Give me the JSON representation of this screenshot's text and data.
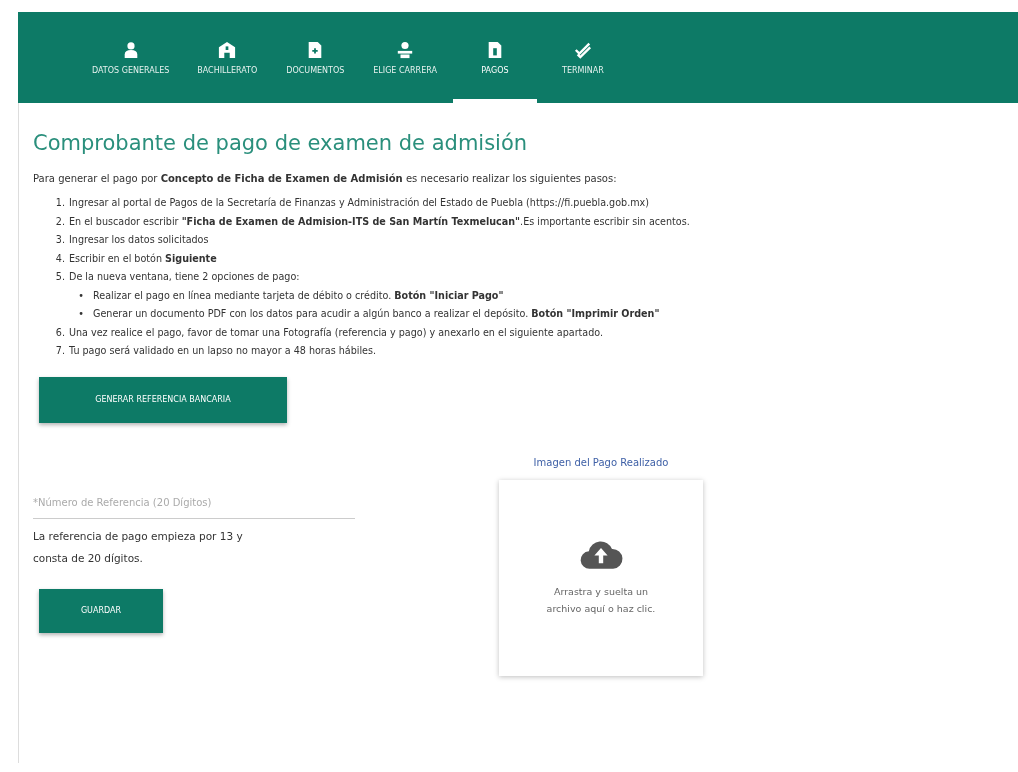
{
  "tabs": [
    {
      "label": "DATOS GENERALES",
      "kind": "person",
      "selected": false
    },
    {
      "label": "BACHILLERATO",
      "kind": "school",
      "selected": false
    },
    {
      "label": "DOCUMENTOS",
      "kind": "file",
      "selected": false
    },
    {
      "label": "ELIGE CARRERA",
      "kind": "career",
      "selected": false
    },
    {
      "label": "PAGOS",
      "kind": "payment",
      "selected": true
    },
    {
      "label": "TERMINAR",
      "kind": "check",
      "selected": false
    }
  ],
  "title": "Comprobante de pago de examen de admisión",
  "intro": "Para generar el pago por **Concepto de Ficha de Examen de Admisión** es necesario realizar los siguientes pasos:",
  "steps": [
    {
      "number": "1.",
      "text": "Ingresar al portal de Pagos de la Secretaría de Finanzas y Administración del Estado de Puebla (https://fi.puebla.gob.mx)"
    },
    {
      "number": "2.",
      "text": "En el buscador escribir **\"Ficha de Examen de Admision-ITS de San Martín Texmelucan\"**.Es importante escribir sin acentos."
    },
    {
      "number": "3.",
      "text": "Ingresar los datos solicitados"
    },
    {
      "number": "4.",
      "text": "Escribir en el botón **Siguiente**"
    },
    {
      "number": "5.",
      "text": "De la nueva ventana, tiene 2 opciones de pago:",
      "children": [
        {
          "bullet": "•",
          "text": "Realizar el pago en línea mediante tarjeta de débito o crédito. **Botón \"Iniciar Pago\"**"
        },
        {
          "bullet": "•",
          "text": "Generar un documento PDF con los datos para acudir a algún banco a realizar el depósito. **Botón \"Imprimir Orden\"**"
        }
      ]
    },
    {
      "number": "6.",
      "text": "Una vez realice el pago, favor de tomar una Fotografía (referencia y pago) y anexarlo en el siguiente apartado."
    },
    {
      "number": "7.",
      "text": "Tu pago será validado en un lapso no mayor a 48 horas hábiles."
    }
  ],
  "generate_button": "GENERAR REFERENCIA BANCARIA",
  "reference_field": {
    "placeholder": "*Número de Referencia (20 Dígitos)"
  },
  "reference_hint": "La referencia de pago empieza por 13 y consta de 20 dígitos.",
  "save_button": "GUARDAR",
  "upload": {
    "label": "Imagen del Pago Realizado",
    "prompt": "Arrastra y suelta un archivo aquí o haz clic."
  }
}
